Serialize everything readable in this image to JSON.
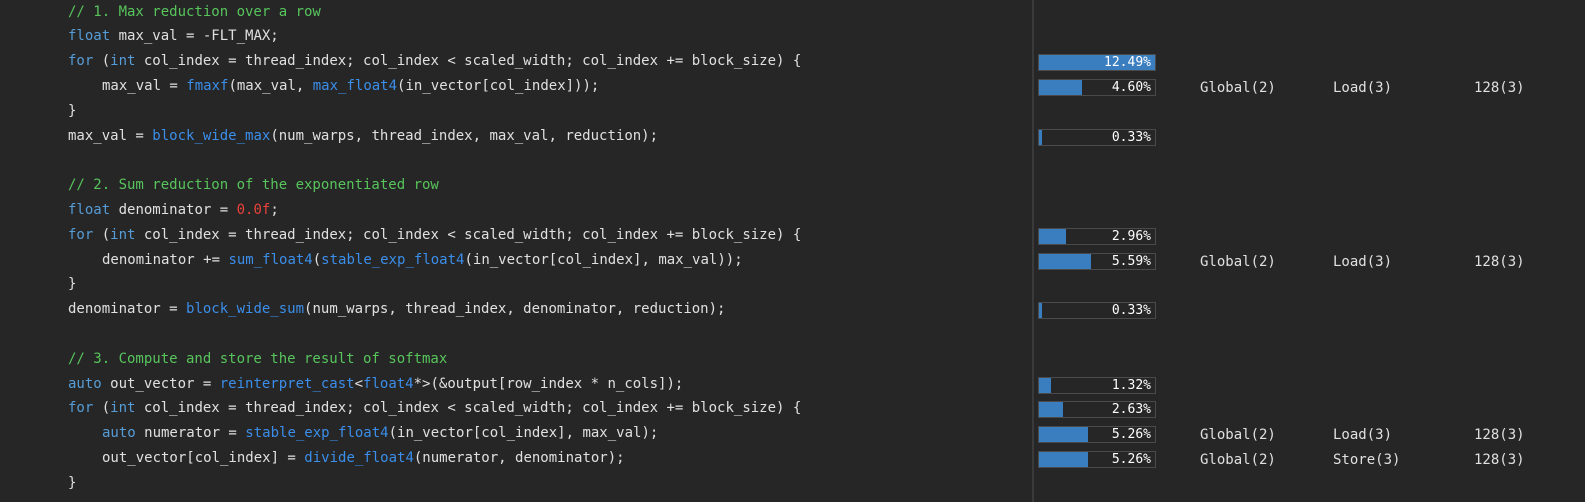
{
  "code": {
    "lines": [
      {
        "indent": false,
        "tokens": [
          {
            "t": "// 1. Max reduction over a row",
            "c": "cm"
          }
        ]
      },
      {
        "indent": false,
        "tokens": [
          {
            "t": "float",
            "c": "kw"
          },
          {
            "t": " max_val = -FLT_MAX;",
            "c": ""
          }
        ]
      },
      {
        "indent": false,
        "tokens": [
          {
            "t": "for",
            "c": "kw"
          },
          {
            "t": " (",
            "c": ""
          },
          {
            "t": "int",
            "c": "kw"
          },
          {
            "t": " col_index = thread_index; col_index < scaled_width; col_index += block_size) {",
            "c": ""
          }
        ]
      },
      {
        "indent": true,
        "tokens": [
          {
            "t": "max_val = ",
            "c": ""
          },
          {
            "t": "fmaxf",
            "c": "fn"
          },
          {
            "t": "(max_val, ",
            "c": ""
          },
          {
            "t": "max_float4",
            "c": "fn"
          },
          {
            "t": "(in_vector[col_index]));",
            "c": ""
          }
        ]
      },
      {
        "indent": false,
        "tokens": [
          {
            "t": "}",
            "c": ""
          }
        ]
      },
      {
        "indent": false,
        "tokens": [
          {
            "t": "max_val = ",
            "c": ""
          },
          {
            "t": "block_wide_max",
            "c": "fn"
          },
          {
            "t": "(num_warps, thread_index, max_val, reduction);",
            "c": ""
          }
        ]
      },
      {
        "indent": false,
        "tokens": []
      },
      {
        "indent": false,
        "tokens": [
          {
            "t": "// 2. Sum reduction of the exponentiated row",
            "c": "cm"
          }
        ]
      },
      {
        "indent": false,
        "tokens": [
          {
            "t": "float",
            "c": "kw"
          },
          {
            "t": " denominator = ",
            "c": ""
          },
          {
            "t": "0.0f",
            "c": "num"
          },
          {
            "t": ";",
            "c": ""
          }
        ]
      },
      {
        "indent": false,
        "tokens": [
          {
            "t": "for",
            "c": "kw"
          },
          {
            "t": " (",
            "c": ""
          },
          {
            "t": "int",
            "c": "kw"
          },
          {
            "t": " col_index = thread_index; col_index < scaled_width; col_index += block_size) {",
            "c": ""
          }
        ]
      },
      {
        "indent": true,
        "tokens": [
          {
            "t": "denominator += ",
            "c": ""
          },
          {
            "t": "sum_float4",
            "c": "fn"
          },
          {
            "t": "(",
            "c": ""
          },
          {
            "t": "stable_exp_float4",
            "c": "fn"
          },
          {
            "t": "(in_vector[col_index], max_val));",
            "c": ""
          }
        ]
      },
      {
        "indent": false,
        "tokens": [
          {
            "t": "}",
            "c": ""
          }
        ]
      },
      {
        "indent": false,
        "tokens": [
          {
            "t": "denominator = ",
            "c": ""
          },
          {
            "t": "block_wide_sum",
            "c": "fn"
          },
          {
            "t": "(num_warps, thread_index, denominator, reduction);",
            "c": ""
          }
        ]
      },
      {
        "indent": false,
        "tokens": []
      },
      {
        "indent": false,
        "tokens": [
          {
            "t": "// 3. Compute and store the result of softmax",
            "c": "cm"
          }
        ]
      },
      {
        "indent": false,
        "tokens": [
          {
            "t": "auto",
            "c": "kw"
          },
          {
            "t": " out_vector = ",
            "c": ""
          },
          {
            "t": "reinterpret_cast",
            "c": "fn"
          },
          {
            "t": "<",
            "c": ""
          },
          {
            "t": "float4",
            "c": "fn"
          },
          {
            "t": "*>(&output[row_index * n_cols]);",
            "c": ""
          }
        ]
      },
      {
        "indent": false,
        "tokens": [
          {
            "t": "for",
            "c": "kw"
          },
          {
            "t": " (",
            "c": ""
          },
          {
            "t": "int",
            "c": "kw"
          },
          {
            "t": " col_index = thread_index; col_index < scaled_width; col_index += block_size) {",
            "c": ""
          }
        ]
      },
      {
        "indent": true,
        "tokens": [
          {
            "t": "auto",
            "c": "kw"
          },
          {
            "t": " numerator = ",
            "c": ""
          },
          {
            "t": "stable_exp_float4",
            "c": "fn"
          },
          {
            "t": "(in_vector[col_index], max_val);",
            "c": ""
          }
        ]
      },
      {
        "indent": true,
        "tokens": [
          {
            "t": "out_vector[col_index] = ",
            "c": ""
          },
          {
            "t": "divide_float4",
            "c": "fn"
          },
          {
            "t": "(numerator, denominator);",
            "c": ""
          }
        ]
      },
      {
        "indent": false,
        "tokens": [
          {
            "t": "}",
            "c": ""
          }
        ]
      }
    ]
  },
  "stats": [
    {
      "line": 2,
      "label": "12.49%",
      "fraction": 0.1249,
      "memory": "",
      "op": "",
      "size": ""
    },
    {
      "line": 3,
      "label": "4.60%",
      "fraction": 0.046,
      "memory": "Global(2)",
      "op": "Load(3)",
      "size": "128(3)"
    },
    {
      "line": 5,
      "label": "0.33%",
      "fraction": 0.0033,
      "memory": "",
      "op": "",
      "size": ""
    },
    {
      "line": 9,
      "label": "2.96%",
      "fraction": 0.0296,
      "memory": "",
      "op": "",
      "size": ""
    },
    {
      "line": 10,
      "label": "5.59%",
      "fraction": 0.0559,
      "memory": "Global(2)",
      "op": "Load(3)",
      "size": "128(3)"
    },
    {
      "line": 12,
      "label": "0.33%",
      "fraction": 0.0033,
      "memory": "",
      "op": "",
      "size": ""
    },
    {
      "line": 15,
      "label": "1.32%",
      "fraction": 0.0132,
      "memory": "",
      "op": "",
      "size": ""
    },
    {
      "line": 16,
      "label": "2.63%",
      "fraction": 0.0263,
      "memory": "",
      "op": "",
      "size": ""
    },
    {
      "line": 17,
      "label": "5.26%",
      "fraction": 0.0526,
      "memory": "Global(2)",
      "op": "Load(3)",
      "size": "128(3)"
    },
    {
      "line": 18,
      "label": "5.26%",
      "fraction": 0.0526,
      "memory": "Global(2)",
      "op": "Store(3)",
      "size": "128(3)"
    }
  ],
  "colors": {
    "comment": "#57c45c",
    "keyword": "#569cd6",
    "function": "#3b8eea",
    "number": "#e8423a",
    "bar": "#3a7ec0",
    "background": "#262626"
  }
}
